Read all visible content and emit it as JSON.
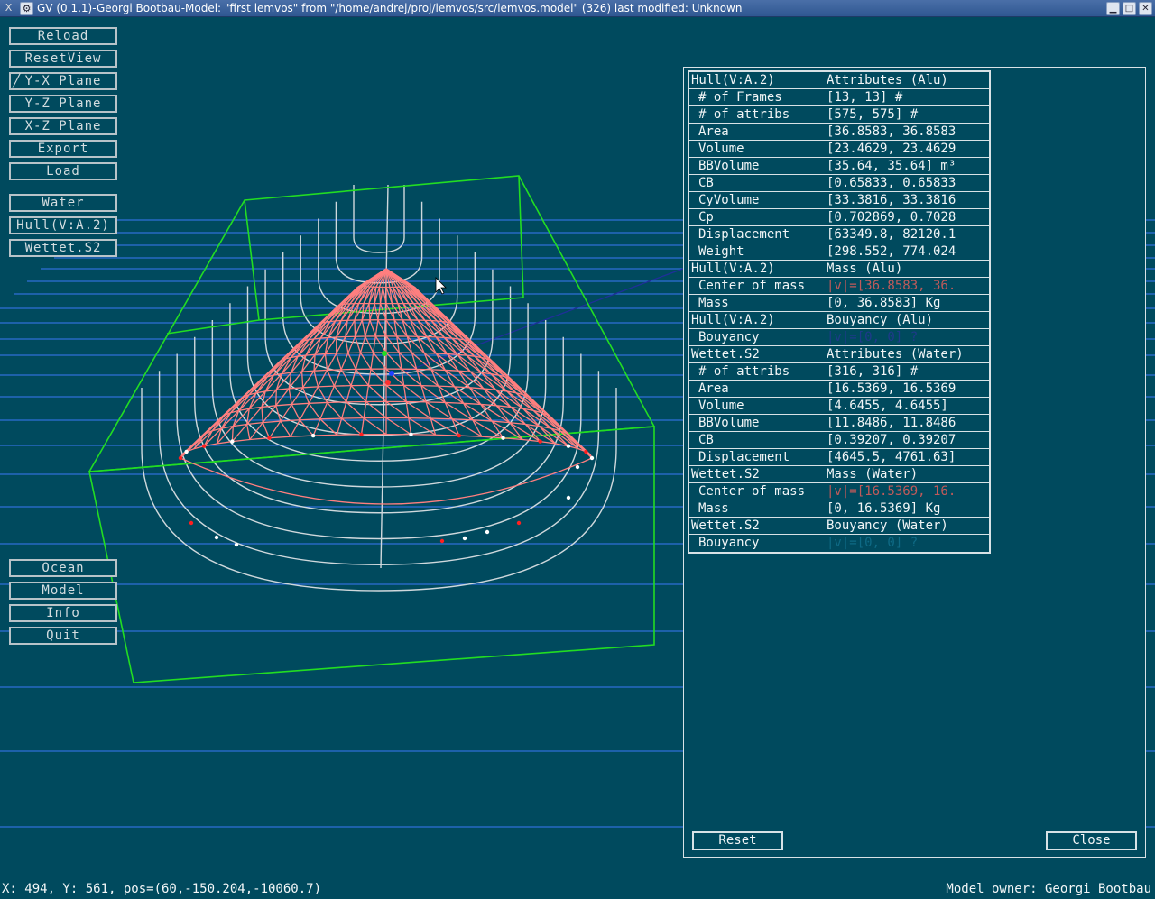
{
  "window": {
    "title": "GV (0.1.1)-Georgi Bootbau-Model: \"first lemvos\" from \"/home/andrej/proj/lemvos/src/lemvos.model\" (326) last modified: Unknown",
    "app_icon": "X",
    "menu_icon": "⚙",
    "minimize": "▁",
    "maximize": "□",
    "close": "✕"
  },
  "toolbar": {
    "reload": "Reload",
    "reset_view": "ResetView",
    "yx_plane": "Y-X Plane",
    "yx_plane_checked": true,
    "yz_plane": "Y-Z Plane",
    "xz_plane": "X-Z Plane",
    "export": "Export",
    "load": "Load",
    "water": "Water",
    "hull": "Hull(V:A.2)",
    "wettet": "Wettet.S2"
  },
  "bottom_menu": {
    "ocean": "Ocean",
    "model": "Model",
    "info": "Info",
    "quit": "Quit"
  },
  "info": {
    "rows": [
      {
        "k": "Hull(V:A.2)",
        "v": "Attributes (Alu)",
        "indent": false,
        "style": ""
      },
      {
        "k": "# of Frames",
        "v": "[13, 13] #",
        "indent": true,
        "style": ""
      },
      {
        "k": "# of attribs",
        "v": "[575, 575] #",
        "indent": true,
        "style": ""
      },
      {
        "k": "Area",
        "v": "[36.8583, 36.8583",
        "indent": true,
        "style": ""
      },
      {
        "k": "Volume",
        "v": "[23.4629, 23.4629",
        "indent": true,
        "style": ""
      },
      {
        "k": "BBVolume",
        "v": "[35.64, 35.64] m³",
        "indent": true,
        "style": ""
      },
      {
        "k": "CB",
        "v": "[0.65833, 0.65833",
        "indent": true,
        "style": ""
      },
      {
        "k": "CyVolume",
        "v": "[33.3816, 33.3816",
        "indent": true,
        "style": ""
      },
      {
        "k": "Cp",
        "v": "[0.702869, 0.7028",
        "indent": true,
        "style": ""
      },
      {
        "k": "Displacement",
        "v": "[63349.8, 82120.1",
        "indent": true,
        "style": ""
      },
      {
        "k": "Weight",
        "v": "[298.552, 774.024",
        "indent": true,
        "style": ""
      },
      {
        "k": "Hull(V:A.2)",
        "v": "Mass (Alu)",
        "indent": false,
        "style": ""
      },
      {
        "k": "Center of mass",
        "v": "|v|=[36.8583, 36.",
        "indent": true,
        "style": "red"
      },
      {
        "k": "Mass",
        "v": "[0, 36.8583] Kg",
        "indent": true,
        "style": ""
      },
      {
        "k": "Hull(V:A.2)",
        "v": "Bouyancy (Alu)",
        "indent": false,
        "style": ""
      },
      {
        "k": "Bouyancy",
        "v": "|v|=[0, 0] ?",
        "indent": true,
        "style": "blue"
      },
      {
        "k": "Wettet.S2",
        "v": "Attributes (Water)",
        "indent": false,
        "style": ""
      },
      {
        "k": "# of attribs",
        "v": "[316, 316] #",
        "indent": true,
        "style": ""
      },
      {
        "k": "Area",
        "v": "[16.5369, 16.5369",
        "indent": true,
        "style": ""
      },
      {
        "k": "Volume",
        "v": "[4.6455, 4.6455]",
        "indent": true,
        "style": ""
      },
      {
        "k": "BBVolume",
        "v": "[11.8486, 11.8486",
        "indent": true,
        "style": ""
      },
      {
        "k": "CB",
        "v": "[0.39207, 0.39207",
        "indent": true,
        "style": ""
      },
      {
        "k": "Displacement",
        "v": "[4645.5, 4761.63]",
        "indent": true,
        "style": ""
      },
      {
        "k": "Wettet.S2",
        "v": "Mass (Water)",
        "indent": false,
        "style": ""
      },
      {
        "k": "Center of mass",
        "v": "|v|=[16.5369, 16.",
        "indent": true,
        "style": "red"
      },
      {
        "k": "Mass",
        "v": "[0, 16.5369] Kg",
        "indent": true,
        "style": ""
      },
      {
        "k": "Wettet.S2",
        "v": "Bouyancy (Water)",
        "indent": false,
        "style": ""
      },
      {
        "k": "Bouyancy",
        "v": "|v|=[0, 0] ?",
        "indent": true,
        "style": "teal"
      }
    ],
    "reset": "Reset",
    "close": "Close"
  },
  "status": {
    "coords": "X: 494, Y: 561, pos=(60,-150.204,-10060.7)",
    "owner": "Model owner: Georgi Bootbau"
  },
  "colors": {
    "background": "#004a5e",
    "waterlines": "#2f6fd8",
    "bounding_box": "#22dd22",
    "hull_mesh": "#ff7f7f",
    "frames": "#cfd8dc"
  }
}
